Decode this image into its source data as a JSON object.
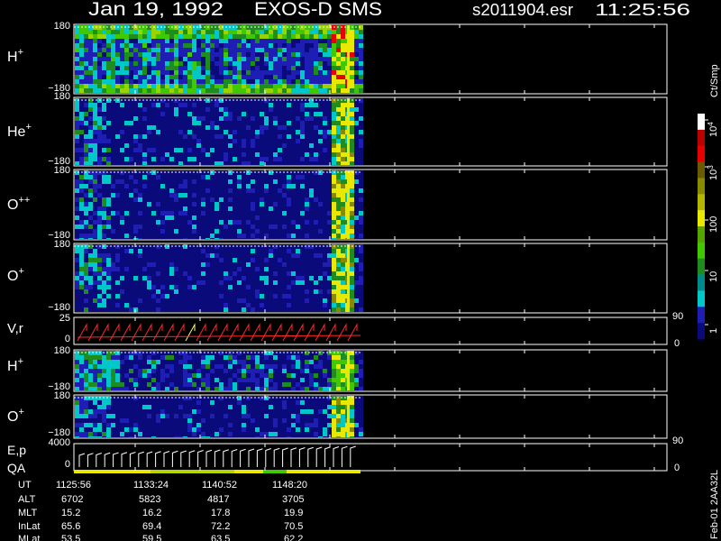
{
  "header": {
    "date": "Jan 19, 1992",
    "instrument": "EXOS-D SMS",
    "file": "s2011904.esr",
    "time": "11:25:56"
  },
  "panels": [
    {
      "label": "H+",
      "ion": "H",
      "charge": "+",
      "top": "180",
      "bottom": "−180"
    },
    {
      "label": "He+",
      "ion": "He",
      "charge": "+",
      "top": "180",
      "bottom": "−180"
    },
    {
      "label": "O++",
      "ion": "O",
      "charge": "++",
      "top": "180",
      "bottom": "−180"
    },
    {
      "label": "O+",
      "ion": "O",
      "charge": "+",
      "top": "180",
      "bottom": "−180"
    },
    {
      "label": "V,r",
      "ion": "V,r",
      "charge": "",
      "top": "25",
      "bottom": "0",
      "right_top": "90",
      "right_bottom": "0"
    },
    {
      "label": "H+",
      "ion": "H",
      "charge": "+",
      "top": "180",
      "bottom": "−180"
    },
    {
      "label": "O+",
      "ion": "O",
      "charge": "+",
      "top": "180",
      "bottom": "−180"
    },
    {
      "label": "E,p",
      "ion": "E,p",
      "charge": "",
      "sub": "QA",
      "top": "4000",
      "bottom": "0",
      "right_top": "90",
      "right_bottom": "0"
    }
  ],
  "colorbar": {
    "unit": "Ct/Smp",
    "ticks": [
      {
        "label": "10",
        "sup": "4"
      },
      {
        "label": "10",
        "sup": "3"
      },
      {
        "label": "100",
        "sup": ""
      },
      {
        "label": "10",
        "sup": ""
      },
      {
        "label": "1",
        "sup": ""
      }
    ],
    "colors": [
      "#ffffff",
      "#bb0000",
      "#e60000",
      "#6b5a00",
      "#8a8a00",
      "#b5b500",
      "#e8e800",
      "#55a500",
      "#40c800",
      "#1e8c1e",
      "#008b8b",
      "#00c8c8",
      "#1e1eb4",
      "#0a0a7a"
    ]
  },
  "footer": {
    "rows": [
      {
        "name": "UT",
        "values": [
          "1125:56",
          "1133:24",
          "1140:52",
          "1148:20"
        ]
      },
      {
        "name": "ALT",
        "values": [
          "6702",
          "5823",
          "4817",
          "3705"
        ]
      },
      {
        "name": "MLT",
        "values": [
          "15.2",
          "16.2",
          "17.8",
          "19.9"
        ]
      },
      {
        "name": "InLat",
        "values": [
          "65.6",
          "69.4",
          "72.2",
          "70.5"
        ]
      },
      {
        "name": "MLat",
        "values": [
          "53.5",
          "59.5",
          "63.5",
          "62.2"
        ]
      }
    ],
    "side_label": "Feb-01 2AA32L"
  },
  "chart_data": {
    "type": "heatmap",
    "title": "Jan 19, 1992   EXOS-D SMS",
    "x": [
      "1125:56",
      "1133:24",
      "1140:52",
      "1148:20"
    ],
    "xlabel": "UT",
    "series": [
      {
        "name": "H+",
        "ylim": [
          -180,
          180
        ]
      },
      {
        "name": "He+",
        "ylim": [
          -180,
          180
        ]
      },
      {
        "name": "O++",
        "ylim": [
          -180,
          180
        ]
      },
      {
        "name": "O+",
        "ylim": [
          -180,
          180
        ]
      },
      {
        "name": "V,r",
        "ylim": [
          0,
          25
        ]
      },
      {
        "name": "H+",
        "ylim": [
          -180,
          180
        ]
      },
      {
        "name": "O+",
        "ylim": [
          -180,
          180
        ]
      },
      {
        "name": "E,p",
        "ylim": [
          0,
          4000
        ]
      }
    ],
    "colorscale": {
      "unit": "Ct/Smp",
      "range": [
        1,
        10000
      ],
      "scale": "log"
    }
  }
}
